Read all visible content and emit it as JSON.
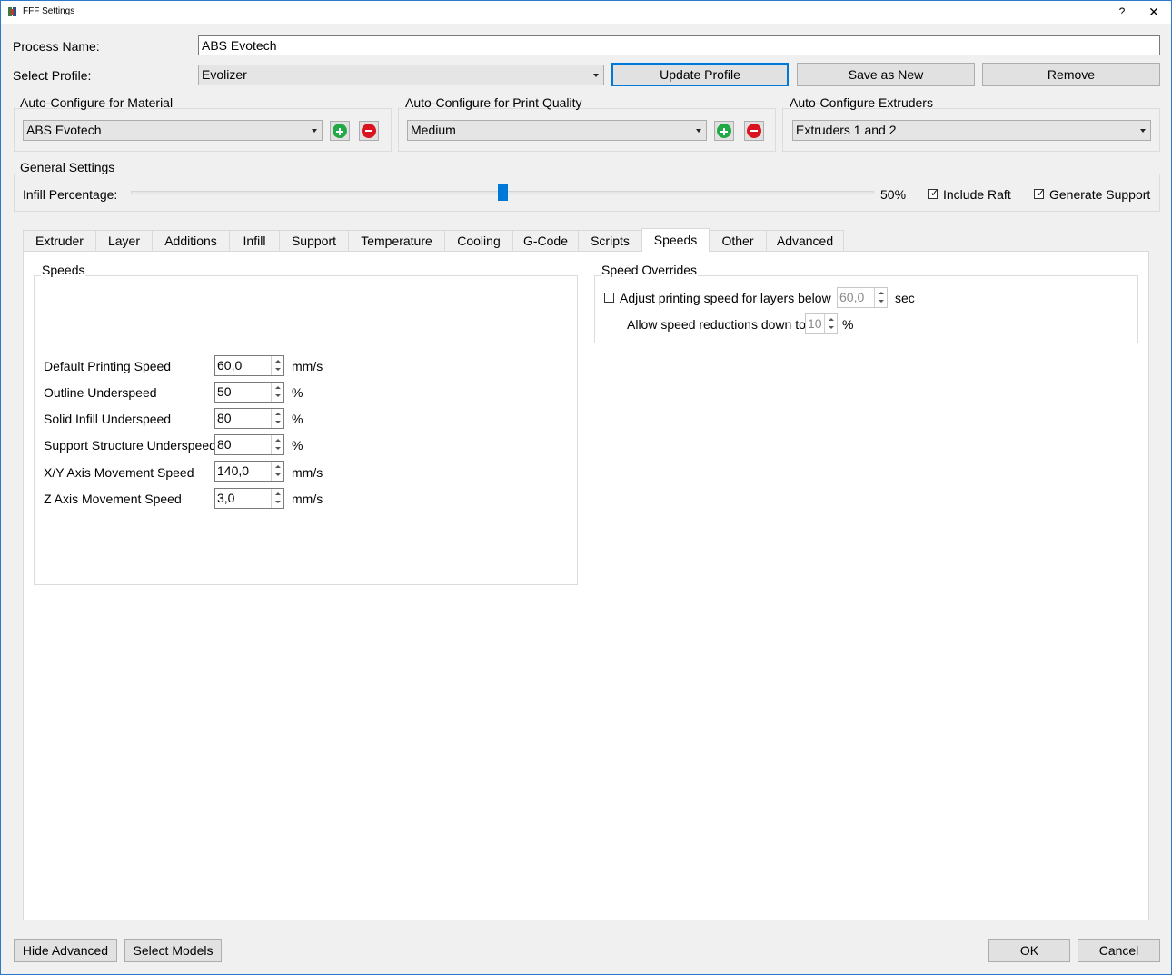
{
  "window": {
    "title": "FFF Settings",
    "help": "?",
    "close": "✕"
  },
  "process": {
    "name_label": "Process Name:",
    "name_value": "ABS Evotech"
  },
  "profile": {
    "label": "Select Profile:",
    "selected": "Evolizer",
    "update_button": "Update Profile",
    "save_new_button": "Save as New",
    "remove_button": "Remove"
  },
  "auto_material": {
    "title": "Auto-Configure for Material",
    "selected": "ABS Evotech"
  },
  "auto_quality": {
    "title": "Auto-Configure for Print Quality",
    "selected": "Medium"
  },
  "auto_extruders": {
    "title": "Auto-Configure Extruders",
    "selected": "Extruders 1 and 2"
  },
  "general": {
    "title": "General Settings",
    "infill_label": "Infill Percentage:",
    "infill_value_text": "50%",
    "infill_value": 0.5,
    "include_raft_label": "Include Raft",
    "include_raft_checked": true,
    "generate_support_label": "Generate Support",
    "generate_support_checked": true
  },
  "tabs": [
    "Extruder",
    "Layer",
    "Additions",
    "Infill",
    "Support",
    "Temperature",
    "Cooling",
    "G-Code",
    "Scripts",
    "Speeds",
    "Other",
    "Advanced"
  ],
  "active_tab": "Speeds",
  "speeds": {
    "title": "Speeds",
    "rows": [
      {
        "label": "Default Printing Speed",
        "value": "60,0",
        "unit": "mm/s"
      },
      {
        "label": "Outline Underspeed",
        "value": "50",
        "unit": "%"
      },
      {
        "label": "Solid Infill Underspeed",
        "value": "80",
        "unit": "%"
      },
      {
        "label": "Support Structure Underspeed",
        "value": "80",
        "unit": "%"
      },
      {
        "label": "X/Y Axis Movement Speed",
        "value": "140,0",
        "unit": "mm/s"
      },
      {
        "label": "Z Axis Movement Speed",
        "value": "3,0",
        "unit": "mm/s"
      }
    ]
  },
  "overrides": {
    "title": "Speed Overrides",
    "adjust_label": "Adjust printing speed for layers below",
    "adjust_checked": false,
    "adjust_value": "60,0",
    "adjust_unit": "sec",
    "reduction_label": "Allow speed reductions down to",
    "reduction_value": "10",
    "reduction_unit": "%"
  },
  "footer": {
    "hide_advanced": "Hide Advanced",
    "select_models": "Select Models",
    "ok": "OK",
    "cancel": "Cancel"
  },
  "colors": {
    "accent": "#0078d7",
    "add": "#22a845",
    "remove": "#d9141e"
  }
}
